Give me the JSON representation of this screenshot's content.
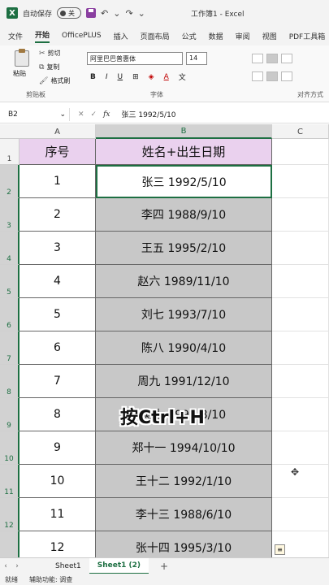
{
  "titlebar": {
    "app_icon": "X",
    "autosave_label": "自动保存",
    "autosave_state": "关",
    "window_title": "工作簿1 - Excel"
  },
  "tabs": [
    "文件",
    "开始",
    "OfficePLUS",
    "插入",
    "页面布局",
    "公式",
    "数据",
    "审阅",
    "视图",
    "PDF工具箱"
  ],
  "ribbon": {
    "paste": "粘贴",
    "cut": "剪切",
    "copy": "复制",
    "format_painter": "格式刷",
    "clipboard_group": "剪贴板",
    "font_name": "阿里巴巴普惠体",
    "font_size": "14",
    "bold": "B",
    "italic": "I",
    "underline": "U",
    "font_color": "A",
    "font_group": "字体",
    "align_group": "对齐方式"
  },
  "formula_bar": {
    "name_box": "B2",
    "cancel": "✕",
    "confirm": "✓",
    "fx": "fx",
    "content": "张三 1992/5/10"
  },
  "columns": [
    "A",
    "B",
    "C"
  ],
  "rows": [
    "1",
    "2",
    "3",
    "4",
    "5",
    "6",
    "7",
    "8",
    "9",
    "10",
    "11",
    "12"
  ],
  "table": {
    "header": [
      "序号",
      "姓名+出生日期"
    ],
    "body": [
      [
        "1",
        "张三 1992/5/10"
      ],
      [
        "2",
        "李四 1988/9/10"
      ],
      [
        "3",
        "王五 1995/2/10"
      ],
      [
        "4",
        "赵六 1989/11/10"
      ],
      [
        "5",
        "刘七 1993/7/10"
      ],
      [
        "6",
        "陈八 1990/4/10"
      ],
      [
        "7",
        "周九 1991/12/10"
      ],
      [
        "8",
        "吴十 1996/8/10"
      ],
      [
        "9",
        "郑十一 1994/10/10"
      ],
      [
        "10",
        "王十二 1992/1/10"
      ],
      [
        "11",
        "李十三 1988/6/10"
      ],
      [
        "12",
        "张十四 1995/3/10"
      ]
    ]
  },
  "overlay": "按Ctrl+H",
  "sheets": [
    "Sheet1",
    "Sheet1 (2)"
  ],
  "add_sheet": "+",
  "status": {
    "ready": "就绪",
    "accessibility": "辅助功能: 调查"
  },
  "colors": {
    "accent": "#1d6f42",
    "header_fill": "#ead1ee",
    "selection_fill": "#c8c8c8"
  }
}
